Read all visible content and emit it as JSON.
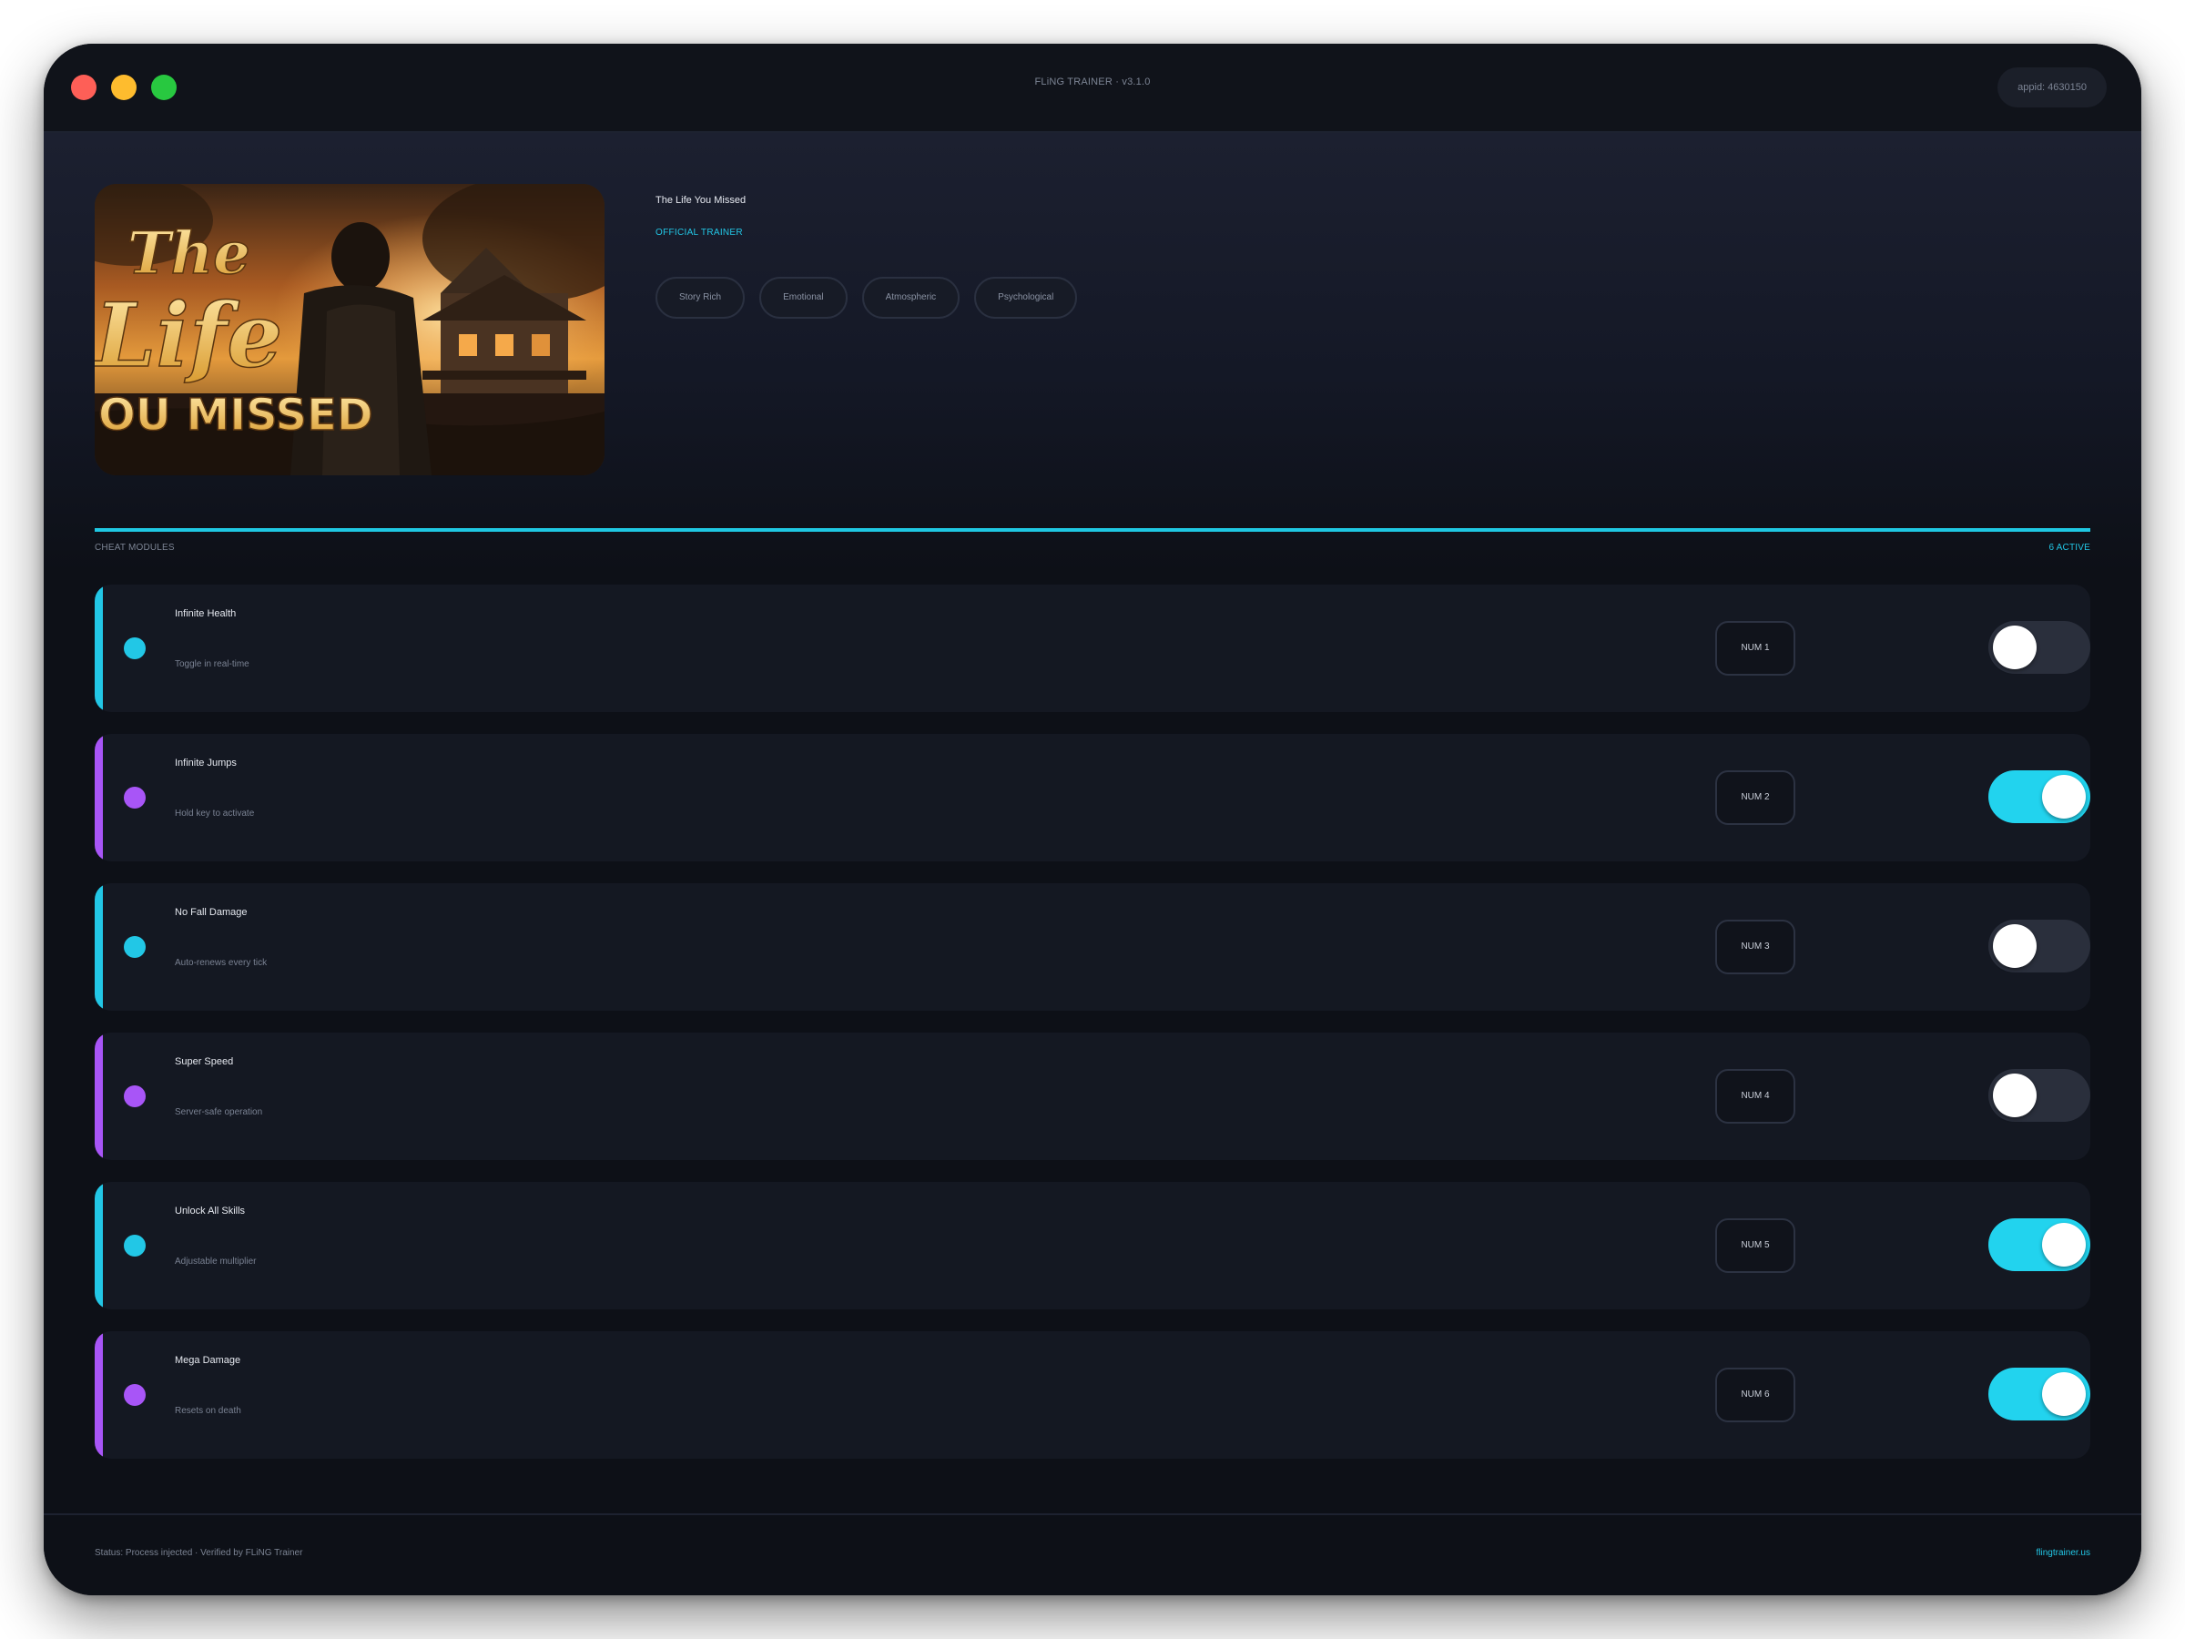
{
  "window": {
    "title": "FLiNG TRAINER · v3.1.0",
    "appid": "appid: 4630150"
  },
  "game": {
    "title": "The Life You Missed",
    "badge": "OFFICIAL TRAINER",
    "cover_text": [
      "The",
      "Life",
      "OU MISSED"
    ],
    "tags": [
      "Story Rich",
      "Emotional",
      "Atmospheric",
      "Psychological"
    ]
  },
  "section": {
    "label": "CHEAT MODULES",
    "active": "6 ACTIVE"
  },
  "modules": [
    {
      "name": "Infinite Health",
      "desc": "Toggle in real-time",
      "key": "NUM 1",
      "enabled": false,
      "accent": "#22c7e6"
    },
    {
      "name": "Infinite Jumps",
      "desc": "Hold key to activate",
      "key": "NUM 2",
      "enabled": true,
      "accent": "#a855f7"
    },
    {
      "name": "No Fall Damage",
      "desc": "Auto-renews every tick",
      "key": "NUM 3",
      "enabled": false,
      "accent": "#22c7e6"
    },
    {
      "name": "Super Speed",
      "desc": "Server-safe operation",
      "key": "NUM 4",
      "enabled": false,
      "accent": "#a855f7"
    },
    {
      "name": "Unlock All Skills",
      "desc": "Adjustable multiplier",
      "key": "NUM 5",
      "enabled": true,
      "accent": "#22c7e6"
    },
    {
      "name": "Mega Damage",
      "desc": "Resets on death",
      "key": "NUM 6",
      "enabled": true,
      "accent": "#a855f7"
    }
  ],
  "footer": {
    "status": "Status: Process injected · Verified by FLiNG Trainer",
    "site": "flingtrainer.us"
  },
  "colors": {
    "accent": "#22c7e6",
    "purple": "#a855f7",
    "toggle_on": "#22d3ee",
    "background": "#0d1017"
  }
}
